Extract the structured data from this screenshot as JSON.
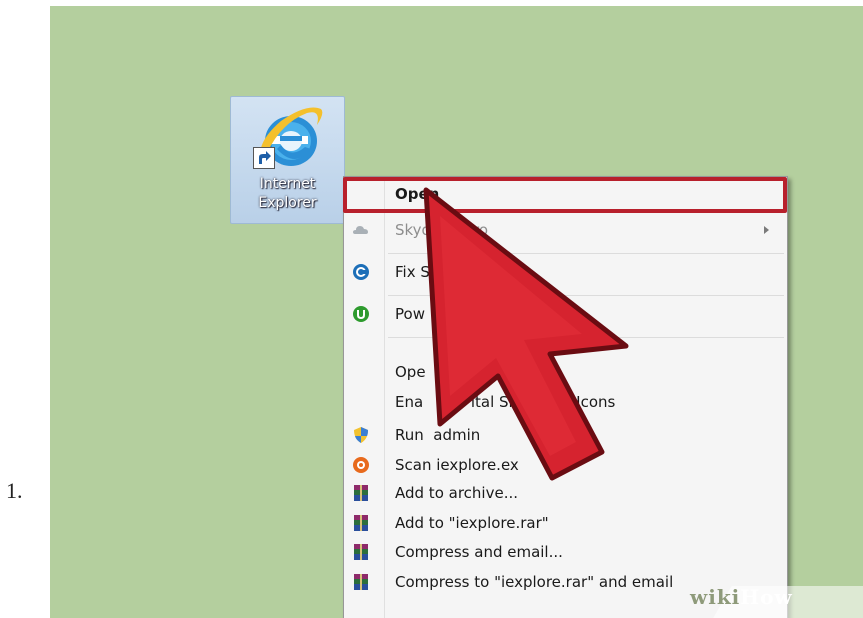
{
  "list_marker": "1.",
  "colors": {
    "desktop_bg": "#b4cf9e",
    "highlight": "#b8202c",
    "cursor_fill": "#d6232f",
    "menu_bg": "#f5f5f5"
  },
  "desktop_icon": {
    "icon": "internet-explorer-icon",
    "label_line1": "Internet",
    "label_line2": "Explorer"
  },
  "context_menu": {
    "items": [
      {
        "label": "Open",
        "bold": true,
        "icon": null
      },
      {
        "label": "Skydrive Pro",
        "greyed": true,
        "icon": "skydrive-cloud-icon",
        "submenu": true
      },
      {
        "label": "Fix S",
        "icon": "fix-tool-icon"
      },
      {
        "label": "Pow",
        "icon": "power-icon"
      },
      {
        "label": "Ope",
        "icon": null
      },
      {
        "label": "Ena          ital Signature Icons",
        "icon": null
      },
      {
        "label": "Run  admin",
        "icon": "uac-shield-icon"
      },
      {
        "label": "Scan iexplore.ex",
        "icon": "antivirus-scan-icon"
      },
      {
        "label": "Add to archive...",
        "icon": "winrar-icon"
      },
      {
        "label": "Add to \"iexplore.rar\"",
        "icon": "winrar-icon"
      },
      {
        "label": "Compress and email...",
        "icon": "winrar-icon"
      },
      {
        "label": "Compress to \"iexplore.rar\" and email",
        "icon": "winrar-icon"
      }
    ]
  },
  "watermark": {
    "part1": "wiki",
    "part2": "How"
  }
}
